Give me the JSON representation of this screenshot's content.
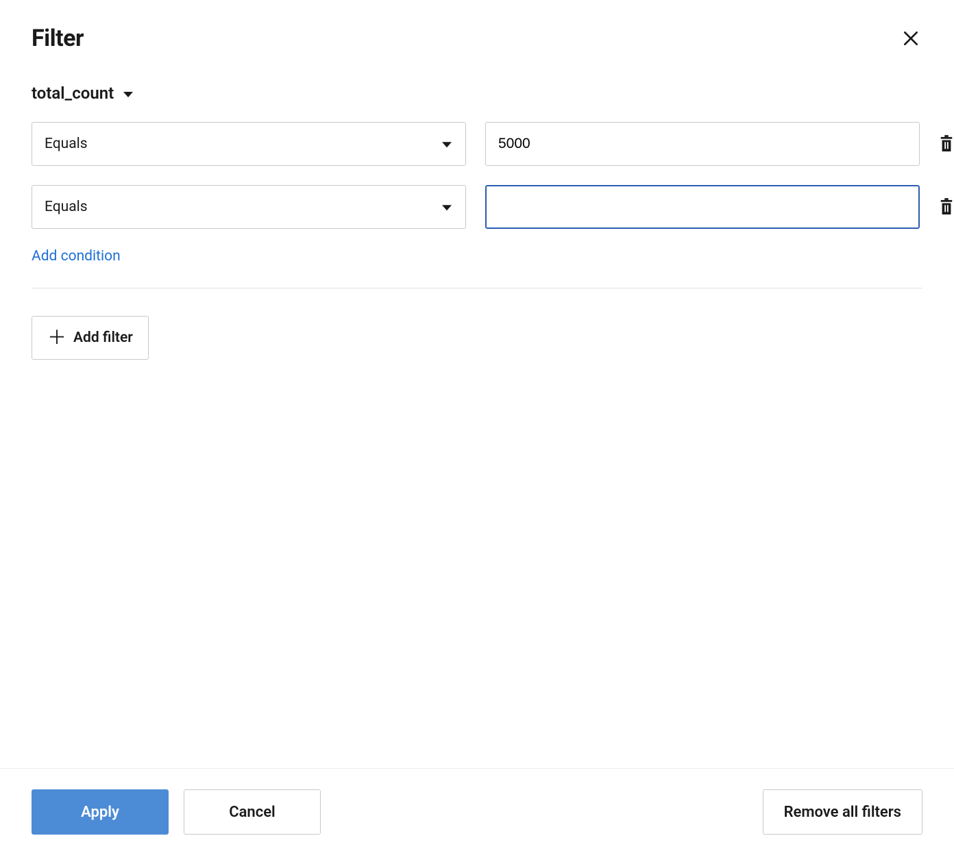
{
  "dialog": {
    "title": "Filter"
  },
  "filter": {
    "field": "total_count",
    "conditions": [
      {
        "operator": "Equals",
        "value": "5000",
        "focused": false
      },
      {
        "operator": "Equals",
        "value": "",
        "focused": true
      }
    ],
    "add_condition_label": "Add condition",
    "add_filter_label": "Add filter"
  },
  "footer": {
    "apply_label": "Apply",
    "cancel_label": "Cancel",
    "remove_all_label": "Remove all filters"
  }
}
